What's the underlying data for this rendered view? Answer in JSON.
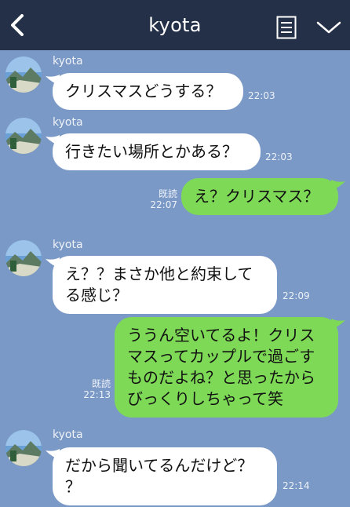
{
  "header": {
    "title": "kyota"
  },
  "colors": {
    "header_bg": "#243048",
    "chat_bg": "#7b99c6",
    "incoming_bubble": "#ffffff",
    "outgoing_bubble": "#7ed957"
  },
  "icons": {
    "back": "chevron-left-icon",
    "menu": "note-list-icon",
    "collapse": "chevron-down-icon",
    "avatar": "mountain-landscape-avatar"
  },
  "messages": [
    {
      "direction": "in",
      "sender": "kyota",
      "lines": [
        "クリスマスどうする？"
      ],
      "time": "22:03"
    },
    {
      "direction": "in",
      "sender": "kyota",
      "lines": [
        "行きたい場所とかある？"
      ],
      "time": "22:03"
    },
    {
      "direction": "out",
      "lines": [
        "え？クリスマス？"
      ],
      "read": "既読",
      "time": "22:07"
    },
    {
      "direction": "in",
      "sender": "kyota",
      "lines": [
        "え？？まさか他と約束して",
        "る感じ？"
      ],
      "time": "22:09"
    },
    {
      "direction": "out",
      "lines": [
        "ううん空いてるよ！クリス",
        "マスってカップルで過ごす",
        "ものだよね？と思ったから",
        "びっくりしちゃって笑"
      ],
      "read": "既読",
      "time": "22:13"
    },
    {
      "direction": "in",
      "sender": "kyota",
      "lines": [
        "だから聞いてるんだけど？",
        "？"
      ],
      "time": "22:14"
    }
  ]
}
